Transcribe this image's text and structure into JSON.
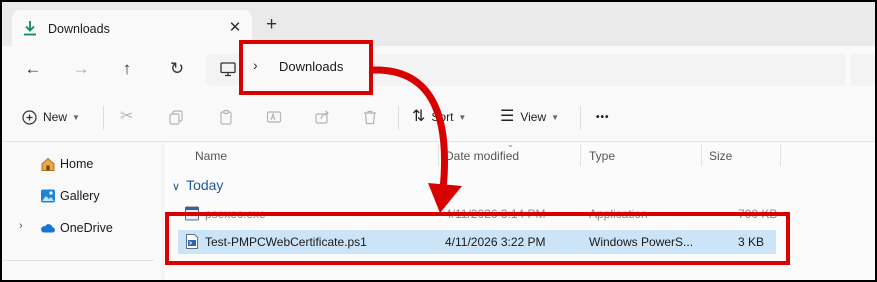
{
  "tab": {
    "title": "Downloads",
    "close": "✕",
    "new_tab": "+"
  },
  "nav": {
    "back": "←",
    "forward": "→",
    "up": "↑",
    "refresh": "↻"
  },
  "address": {
    "chevron": "›",
    "current": "Downloads"
  },
  "toolbar": {
    "new_label": "New",
    "sort_label": "Sort",
    "view_label": "View",
    "more": "•••"
  },
  "sidebar": {
    "items": [
      {
        "label": "Home",
        "icon": "home-icon"
      },
      {
        "label": "Gallery",
        "icon": "gallery-icon"
      },
      {
        "label": "OneDrive",
        "icon": "onedrive-icon"
      }
    ]
  },
  "columns": {
    "name": "Name",
    "date": "Date modified",
    "type": "Type",
    "size": "Size"
  },
  "group": {
    "label": "Today"
  },
  "files": [
    {
      "name": "psexec.exe",
      "date": "4/11/2026 3:14 PM",
      "type": "Application",
      "size": "700 KB"
    },
    {
      "name": "Test-PMPCWebCertificate.ps1",
      "date": "4/11/2026 3:22 PM",
      "type": "Windows PowerS...",
      "size": "3 KB"
    }
  ],
  "colors": {
    "highlight": "#d80000",
    "selection": "#cce4f7",
    "accent": "#0f8a5f"
  }
}
